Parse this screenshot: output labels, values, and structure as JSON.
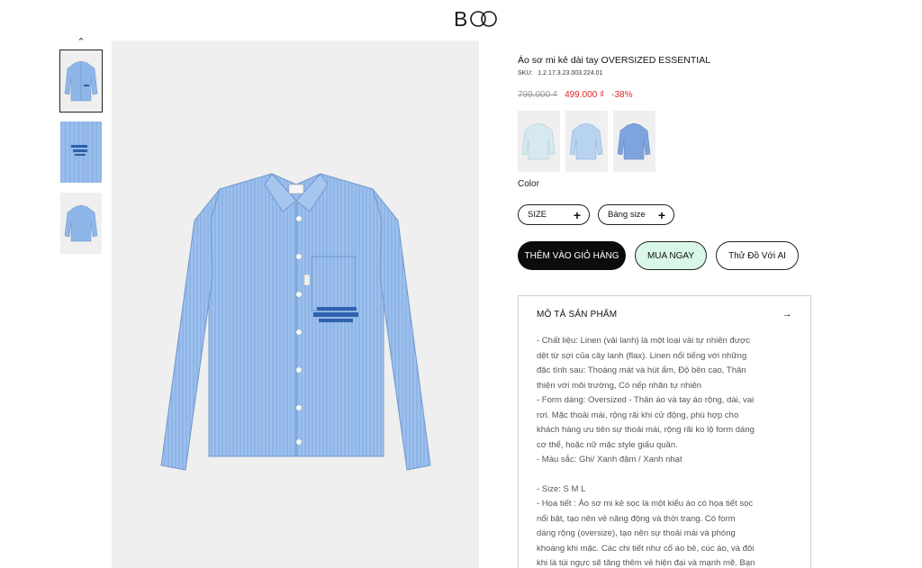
{
  "brand": {
    "logo_text": "B"
  },
  "gallery": {
    "up_icon": "chevron-up-icon",
    "thumbs": [
      {
        "name": "thumb-front",
        "active": true
      },
      {
        "name": "thumb-detail",
        "active": false
      },
      {
        "name": "thumb-back",
        "active": false
      }
    ]
  },
  "product": {
    "title": "Áo sơ mi kẻ dài tay OVERSIZED ESSENTIAL",
    "sku_label": "SKU:",
    "sku": "1.2.17.3.23.003.224.01",
    "price_old": "799.000 ₫",
    "price_new": "499.000 ₫",
    "discount": "-38%",
    "color_label": "Color",
    "colors": [
      "#d6e8f2",
      "#b8d3ef",
      "#7fa3dd"
    ]
  },
  "options": {
    "size_label": "SIZE",
    "size_chart_label": "Bảng size"
  },
  "actions": {
    "add_to_cart": "THÊM VÀO GIỎ HÀNG",
    "buy_now": "MUA NGAY",
    "try_ai": "Thử Đồ Với AI"
  },
  "description": {
    "heading": "MÔ TẢ SẢN PHẨM",
    "lines": [
      "- Chất liệu: Linen (vải lanh) là một loại vải tự nhiên được",
      "dệt từ sợi của cây lanh (flax). Linen nổi tiếng với những",
      "đặc tính sau: Thoáng mát và hút ẩm, Độ bền cao, Thân",
      "thiện với môi trường, Có nếp nhăn tự nhiên",
      "- Form dáng: Oversized - Thân áo và tay áo rộng, dài, vai",
      "rơi. Mặc thoải mái, rộng rãi khi cử động, phù hợp cho",
      "khách hàng ưu tiên sự thoải mái, rộng rãi ko lộ form dáng",
      "cơ thể, hoặc nữ mặc style giấu quần.",
      "- Màu sắc: Ghi/ Xanh đậm / Xanh nhạt",
      "",
      "- Size: S M L",
      "- Họa tiết : Áo sơ mi kẻ sọc là một kiểu áo có họa tiết sọc",
      "nổi bật, tạo nên vẻ năng động và thời trang. Có form",
      "dáng rộng (oversize), tạo nên sự thoải mái và phóng",
      "khoáng khi mặc. Các chi tiết như cổ áo bẻ, cúc áo, và đôi",
      "khi là túi ngực sẽ tăng thêm vẻ hiện đại và mạnh mẽ. Bạn"
    ]
  },
  "colors": {
    "accent_price": "#e0262b",
    "cart_button": "#0c0c0c",
    "buy_button": "#d9f7e6",
    "image_bg": "#efefef",
    "shirt": "#8fb6e8"
  }
}
